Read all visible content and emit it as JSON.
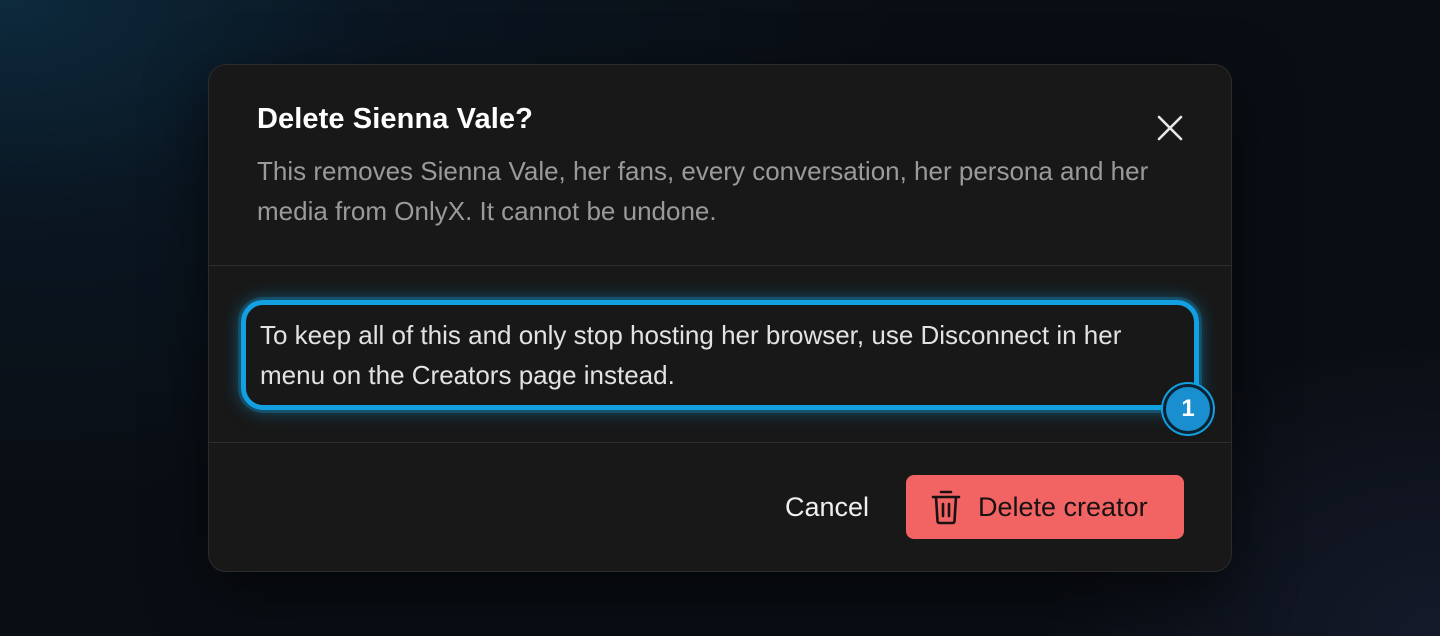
{
  "dialog": {
    "title": "Delete Sienna Vale?",
    "description": "This removes Sienna Vale, her fans, every conversation, her persona and her media from OnlyX. It cannot be undone.",
    "close_icon": "close-icon",
    "note": "To keep all of this and only stop hosting her browser, use Disconnect in her menu on the Creators page instead.",
    "badge": "1",
    "cancel_label": "Cancel",
    "delete_label": "Delete creator",
    "delete_icon": "trash-icon"
  },
  "colors": {
    "accent": "#13a0e0",
    "danger": "#f26464",
    "dialog_bg": "#181818"
  }
}
